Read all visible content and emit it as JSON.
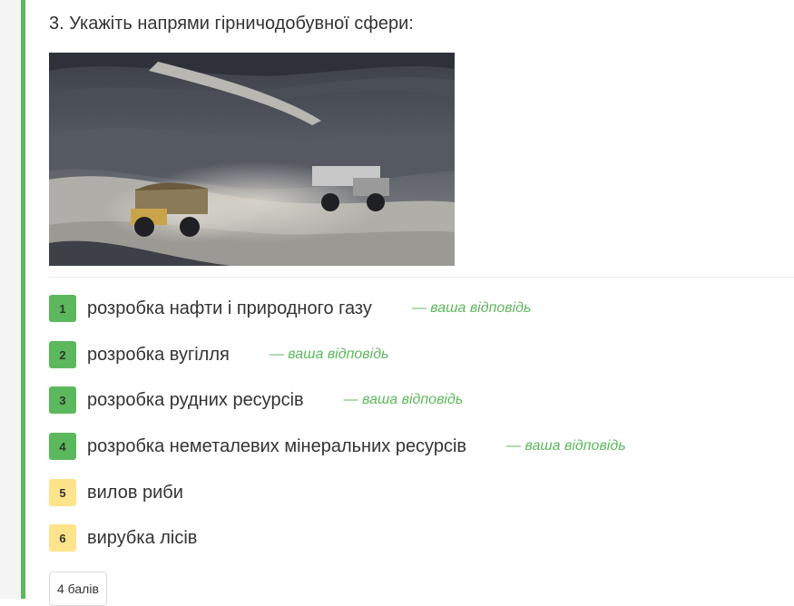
{
  "question": {
    "title": "3. Укажіть напрями гірничодобувної сфери:",
    "image_alt": "mining-dump-trucks-photo"
  },
  "answers": [
    {
      "number": "1",
      "text": "розробка нафти і природного газу",
      "note": "— ваша відповідь",
      "status": "correct"
    },
    {
      "number": "2",
      "text": "розробка вугілля",
      "note": "— ваша відповідь",
      "status": "correct"
    },
    {
      "number": "3",
      "text": "розробка рудних ресурсів",
      "note": "— ваша відповідь",
      "status": "correct"
    },
    {
      "number": "4",
      "text": "розробка неметалевих мінеральних ресурсів",
      "note": "— ваша відповідь",
      "status": "correct"
    },
    {
      "number": "5",
      "text": "вилов риби",
      "status": "neutral"
    },
    {
      "number": "6",
      "text": "вирубка лісів",
      "status": "neutral"
    }
  ],
  "score": {
    "label": "4 балів"
  },
  "colors": {
    "accent": "#5cb85c",
    "neutral_badge": "#fde48a",
    "text": "#333333"
  }
}
